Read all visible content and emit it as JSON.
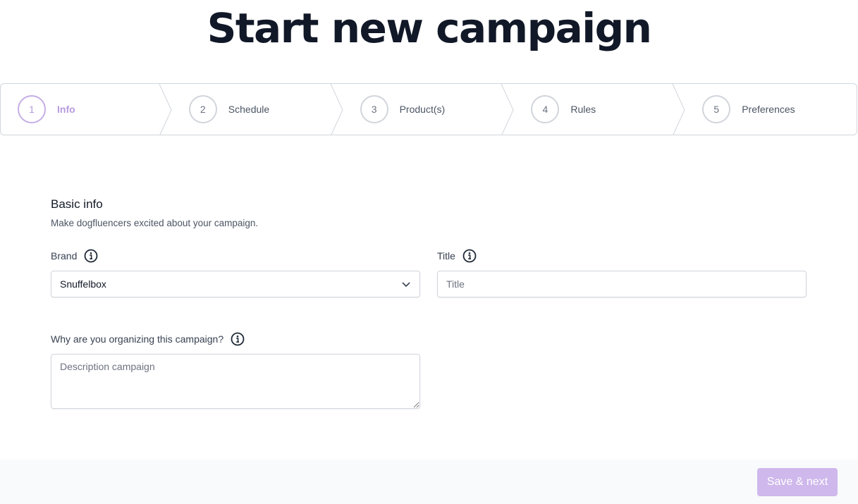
{
  "page": {
    "title": "Start new campaign"
  },
  "stepper": {
    "steps": [
      {
        "number": "1",
        "label": "Info",
        "active": true
      },
      {
        "number": "2",
        "label": "Schedule",
        "active": false
      },
      {
        "number": "3",
        "label": "Product(s)",
        "active": false
      },
      {
        "number": "4",
        "label": "Rules",
        "active": false
      },
      {
        "number": "5",
        "label": "Preferences",
        "active": false
      }
    ],
    "active_color": "#b79bdf"
  },
  "basic_info": {
    "title": "Basic info",
    "subtitle": "Make dogfluencers excited about your campaign."
  },
  "form": {
    "brand": {
      "label": "Brand",
      "value": "Snuffelbox",
      "icon": "info-icon"
    },
    "title": {
      "label": "Title",
      "placeholder": "Title",
      "icon": "info-icon"
    },
    "reason": {
      "label": "Why are you organizing this campaign?",
      "placeholder": "Description campaign",
      "icon": "info-icon"
    }
  },
  "footer": {
    "save_label": "Save & next",
    "button_color": "#cfb8ec"
  }
}
